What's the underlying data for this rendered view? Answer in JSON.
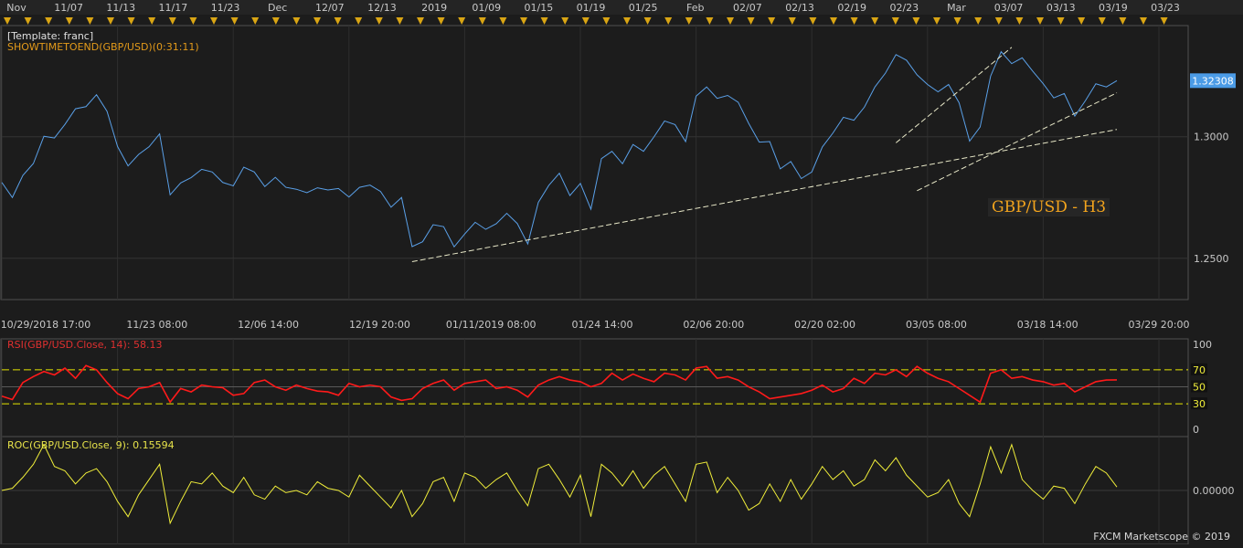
{
  "chart_data": [
    {
      "type": "line",
      "title": "GBP/USD - H3",
      "template_label": "[Template: franc]",
      "indicator_label": "SHOWTIMETOEND(GBP/USD)(0:31:11)",
      "top_axis_labels": [
        "Nov",
        "11/07",
        "11/13",
        "11/17",
        "11/23",
        "Dec",
        "12/07",
        "12/13",
        "2019",
        "01/09",
        "01/15",
        "01/19",
        "01/25",
        "Feb",
        "02/07",
        "02/13",
        "02/19",
        "02/23",
        "Mar",
        "03/07",
        "03/13",
        "03/19",
        "03/23"
      ],
      "bottom_axis_labels": [
        "10/29/2018 17:00",
        "11/23 08:00",
        "12/06 14:00",
        "12/19 20:00",
        "01/11/2019 08:00",
        "01/24 14:00",
        "02/06 20:00",
        "02/20 02:00",
        "03/05 08:00",
        "03/18 14:00",
        "03/29 20:00"
      ],
      "y_tick_labels": [
        "1.3000",
        "1.2500"
      ],
      "ylim": [
        1.233,
        1.345
      ],
      "last_price_label": "1.32308",
      "last_value": 1.32308,
      "series": [
        {
          "values": [
            1.2812,
            1.275,
            1.2841,
            1.289,
            1.3002,
            1.2995,
            1.3051,
            1.3115,
            1.3124,
            1.3173,
            1.3105,
            1.296,
            1.288,
            1.2927,
            1.2959,
            1.3012,
            1.2761,
            1.281,
            1.2832,
            1.2866,
            1.2855,
            1.2812,
            1.2798,
            1.2875,
            1.2855,
            1.2795,
            1.2833,
            1.2792,
            1.2784,
            1.277,
            1.279,
            1.2781,
            1.2787,
            1.2752,
            1.2792,
            1.2801,
            1.2775,
            1.271,
            1.275,
            1.2548,
            1.2568,
            1.2638,
            1.263,
            1.2547,
            1.26,
            1.2648,
            1.2619,
            1.2642,
            1.2685,
            1.2643,
            1.2559,
            1.273,
            1.28,
            1.285,
            1.2758,
            1.2808,
            1.2702,
            1.291,
            1.294,
            1.2889,
            1.2968,
            1.294,
            1.3,
            1.3065,
            1.305,
            1.298,
            1.3167,
            1.3205,
            1.3158,
            1.317,
            1.3142,
            1.3055,
            1.2978,
            1.298,
            1.2868,
            1.2898,
            1.2828,
            1.2855,
            1.2958,
            1.3015,
            1.308,
            1.3068,
            1.3122,
            1.3205,
            1.3262,
            1.3338,
            1.3315,
            1.3255,
            1.3215,
            1.3185,
            1.3215,
            1.314,
            1.2982,
            1.304,
            1.325,
            1.335,
            1.3301,
            1.3325,
            1.327,
            1.3218,
            1.316,
            1.3178,
            1.3085,
            1.3148,
            1.3218,
            1.3205,
            1.3231
          ]
        }
      ],
      "trendlines": [
        {
          "from": [
            39,
            1.2486
          ],
          "to": [
            106,
            1.303
          ]
        },
        {
          "from": [
            87,
            1.2778
          ],
          "to": [
            106,
            1.3181
          ]
        },
        {
          "from": [
            85,
            1.2975
          ],
          "to": [
            96,
            1.3368
          ]
        }
      ]
    },
    {
      "type": "line",
      "title": "RSI(GBP/USD.Close, 14): 58.13",
      "ylim": [
        0,
        100
      ],
      "y_tick_labels": [
        "100",
        "70",
        "50",
        "30",
        "0"
      ],
      "levels": [
        70,
        50,
        30
      ],
      "series": [
        {
          "values": [
            39,
            35,
            55,
            62,
            68,
            64,
            72,
            60,
            75,
            70,
            55,
            42,
            36,
            48,
            50,
            55,
            32,
            48,
            44,
            52,
            50,
            49,
            40,
            42,
            55,
            58,
            50,
            46,
            52,
            48,
            45,
            44,
            40,
            54,
            50,
            52,
            50,
            38,
            34,
            36,
            48,
            54,
            58,
            46,
            54,
            56,
            58,
            48,
            50,
            46,
            38,
            52,
            58,
            62,
            58,
            56,
            50,
            54,
            66,
            58,
            65,
            60,
            56,
            66,
            64,
            58,
            72,
            74,
            60,
            62,
            58,
            50,
            44,
            36,
            38,
            40,
            42,
            46,
            52,
            44,
            48,
            60,
            54,
            66,
            64,
            70,
            62,
            74,
            66,
            60,
            56,
            48,
            40,
            32,
            66,
            70,
            60,
            62,
            58,
            56,
            52,
            54,
            44,
            50,
            56,
            58,
            58.13
          ]
        }
      ]
    },
    {
      "type": "line",
      "title": "ROC(GBP/USD.Close, 9): 0.15594",
      "ylim": [
        -2.3,
        2.3
      ],
      "y_tick_labels": [
        "0.00000"
      ],
      "series": [
        {
          "values": [
            0.0,
            0.1,
            0.6,
            1.2,
            2.1,
            1.1,
            0.9,
            0.3,
            0.8,
            1.0,
            0.4,
            -0.5,
            -1.2,
            -0.2,
            0.5,
            1.2,
            -1.5,
            -0.5,
            0.4,
            0.3,
            0.8,
            0.2,
            -0.1,
            0.6,
            -0.2,
            -0.4,
            0.2,
            -0.1,
            0.0,
            -0.2,
            0.4,
            0.1,
            0.0,
            -0.3,
            0.7,
            0.2,
            -0.3,
            -0.8,
            0.0,
            -1.2,
            -0.6,
            0.4,
            0.6,
            -0.5,
            0.8,
            0.6,
            0.1,
            0.5,
            0.8,
            0.0,
            -0.7,
            1.0,
            1.2,
            0.5,
            -0.3,
            0.7,
            -1.2,
            1.2,
            0.8,
            0.2,
            0.9,
            0.1,
            0.7,
            1.1,
            0.3,
            -0.5,
            1.2,
            1.3,
            -0.1,
            0.6,
            0.0,
            -0.9,
            -0.6,
            0.3,
            -0.5,
            0.5,
            -0.4,
            0.3,
            1.1,
            0.5,
            0.9,
            0.2,
            0.5,
            1.4,
            0.9,
            1.5,
            0.7,
            0.2,
            -0.3,
            -0.1,
            0.5,
            -0.6,
            -1.2,
            0.3,
            2.0,
            0.8,
            2.1,
            0.5,
            0.0,
            -0.4,
            0.2,
            0.1,
            -0.6,
            0.3,
            1.1,
            0.8,
            0.16
          ]
        }
      ]
    }
  ],
  "footer": {
    "brand": "FXCM Marketscope © 2019"
  },
  "colors": {
    "background": "#1c1c1c",
    "price": "#5aa0e8",
    "rsi": "#ff1a1a",
    "roc": "#f0ee3a",
    "trendline": "#e8e8c8",
    "level": "#e6e600",
    "marker": "#d9a514",
    "title": "#f3a41d"
  }
}
